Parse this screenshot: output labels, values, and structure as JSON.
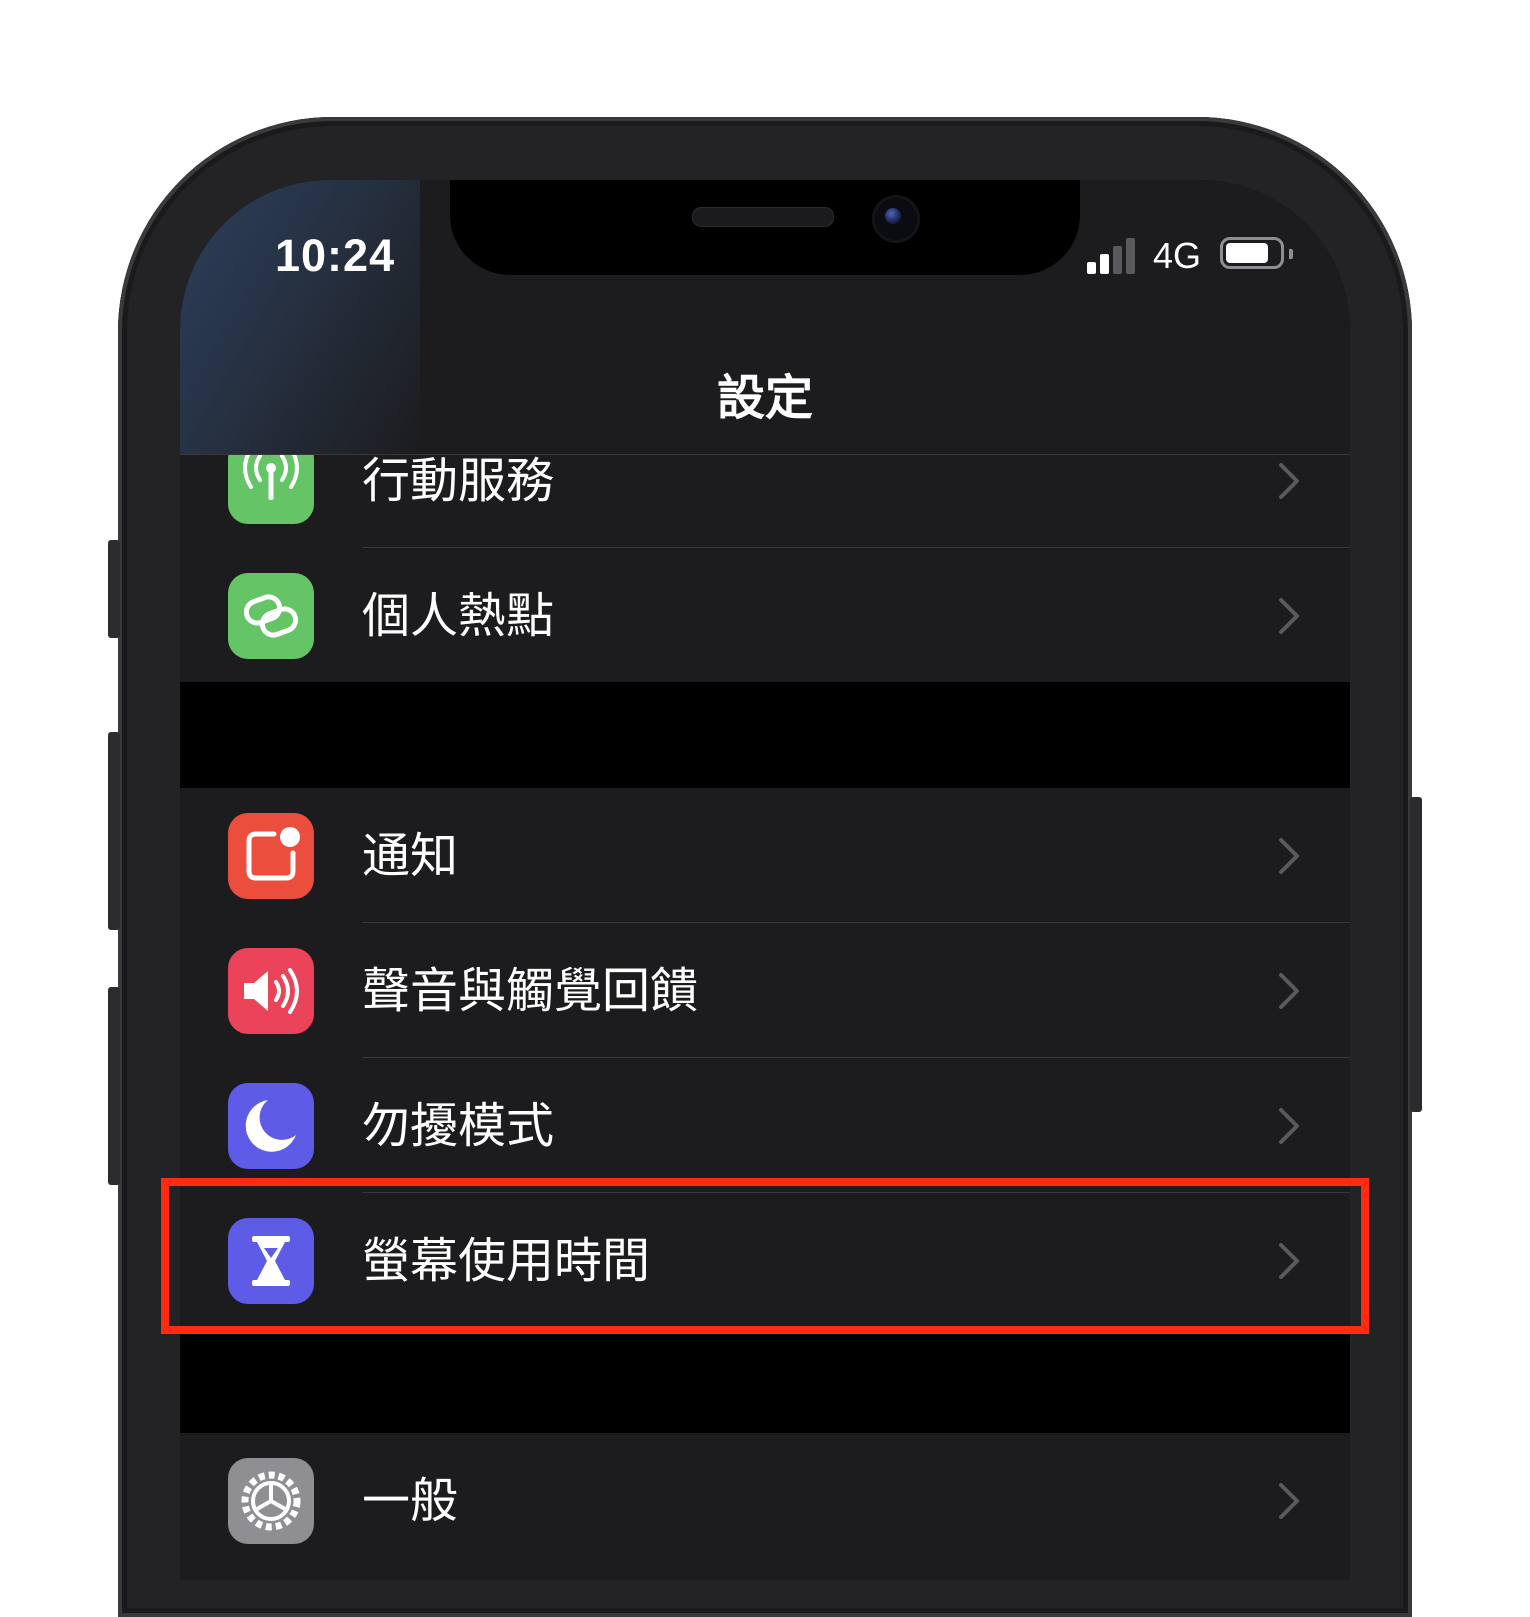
{
  "status_bar": {
    "time": "10:24",
    "network": "4G"
  },
  "nav": {
    "title": "設定"
  },
  "groups": [
    {
      "items": [
        {
          "label": "行動服務",
          "icon": "antenna-icon",
          "color": "#65c466"
        },
        {
          "label": "個人熱點",
          "icon": "hotspot-link-icon",
          "color": "#65c466"
        }
      ]
    },
    {
      "items": [
        {
          "label": "通知",
          "icon": "notification-icon",
          "color": "#eb4e3d"
        },
        {
          "label": "聲音與觸覺回饋",
          "icon": "speaker-icon",
          "color": "#eb445a"
        },
        {
          "label": "勿擾模式",
          "icon": "moon-icon",
          "color": "#5e5ce6"
        },
        {
          "label": "螢幕使用時間",
          "icon": "hourglass-icon",
          "color": "#5e5ce6"
        }
      ]
    },
    {
      "items": [
        {
          "label": "一般",
          "icon": "gear-icon",
          "color": "#8e8e93"
        }
      ]
    }
  ],
  "highlight_color": "#ff2b11"
}
